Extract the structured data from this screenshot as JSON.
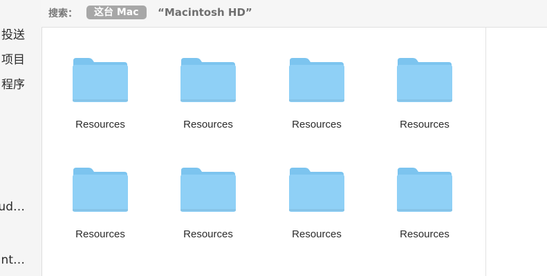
{
  "sidebar": {
    "items": [
      {
        "label": "投送"
      },
      {
        "label": "项目"
      },
      {
        "label": "程序"
      },
      {
        "label": "ud…"
      },
      {
        "label": "int…"
      }
    ]
  },
  "search_scope": {
    "label": "搜索：",
    "selected": "这台 Mac",
    "other": "“Macintosh HD”"
  },
  "files": [
    {
      "name": "Resources",
      "icon": "folder-icon"
    },
    {
      "name": "Resources",
      "icon": "folder-icon"
    },
    {
      "name": "Resources",
      "icon": "folder-icon"
    },
    {
      "name": "Resources",
      "icon": "folder-icon"
    },
    {
      "name": "Resources",
      "icon": "folder-icon"
    },
    {
      "name": "Resources",
      "icon": "folder-icon"
    },
    {
      "name": "Resources",
      "icon": "folder-icon"
    },
    {
      "name": "Resources",
      "icon": "folder-icon"
    }
  ],
  "colors": {
    "folder_back": "#7cc4ef",
    "folder_front": "#8fd0f6",
    "chip": "#a7a7a7"
  }
}
